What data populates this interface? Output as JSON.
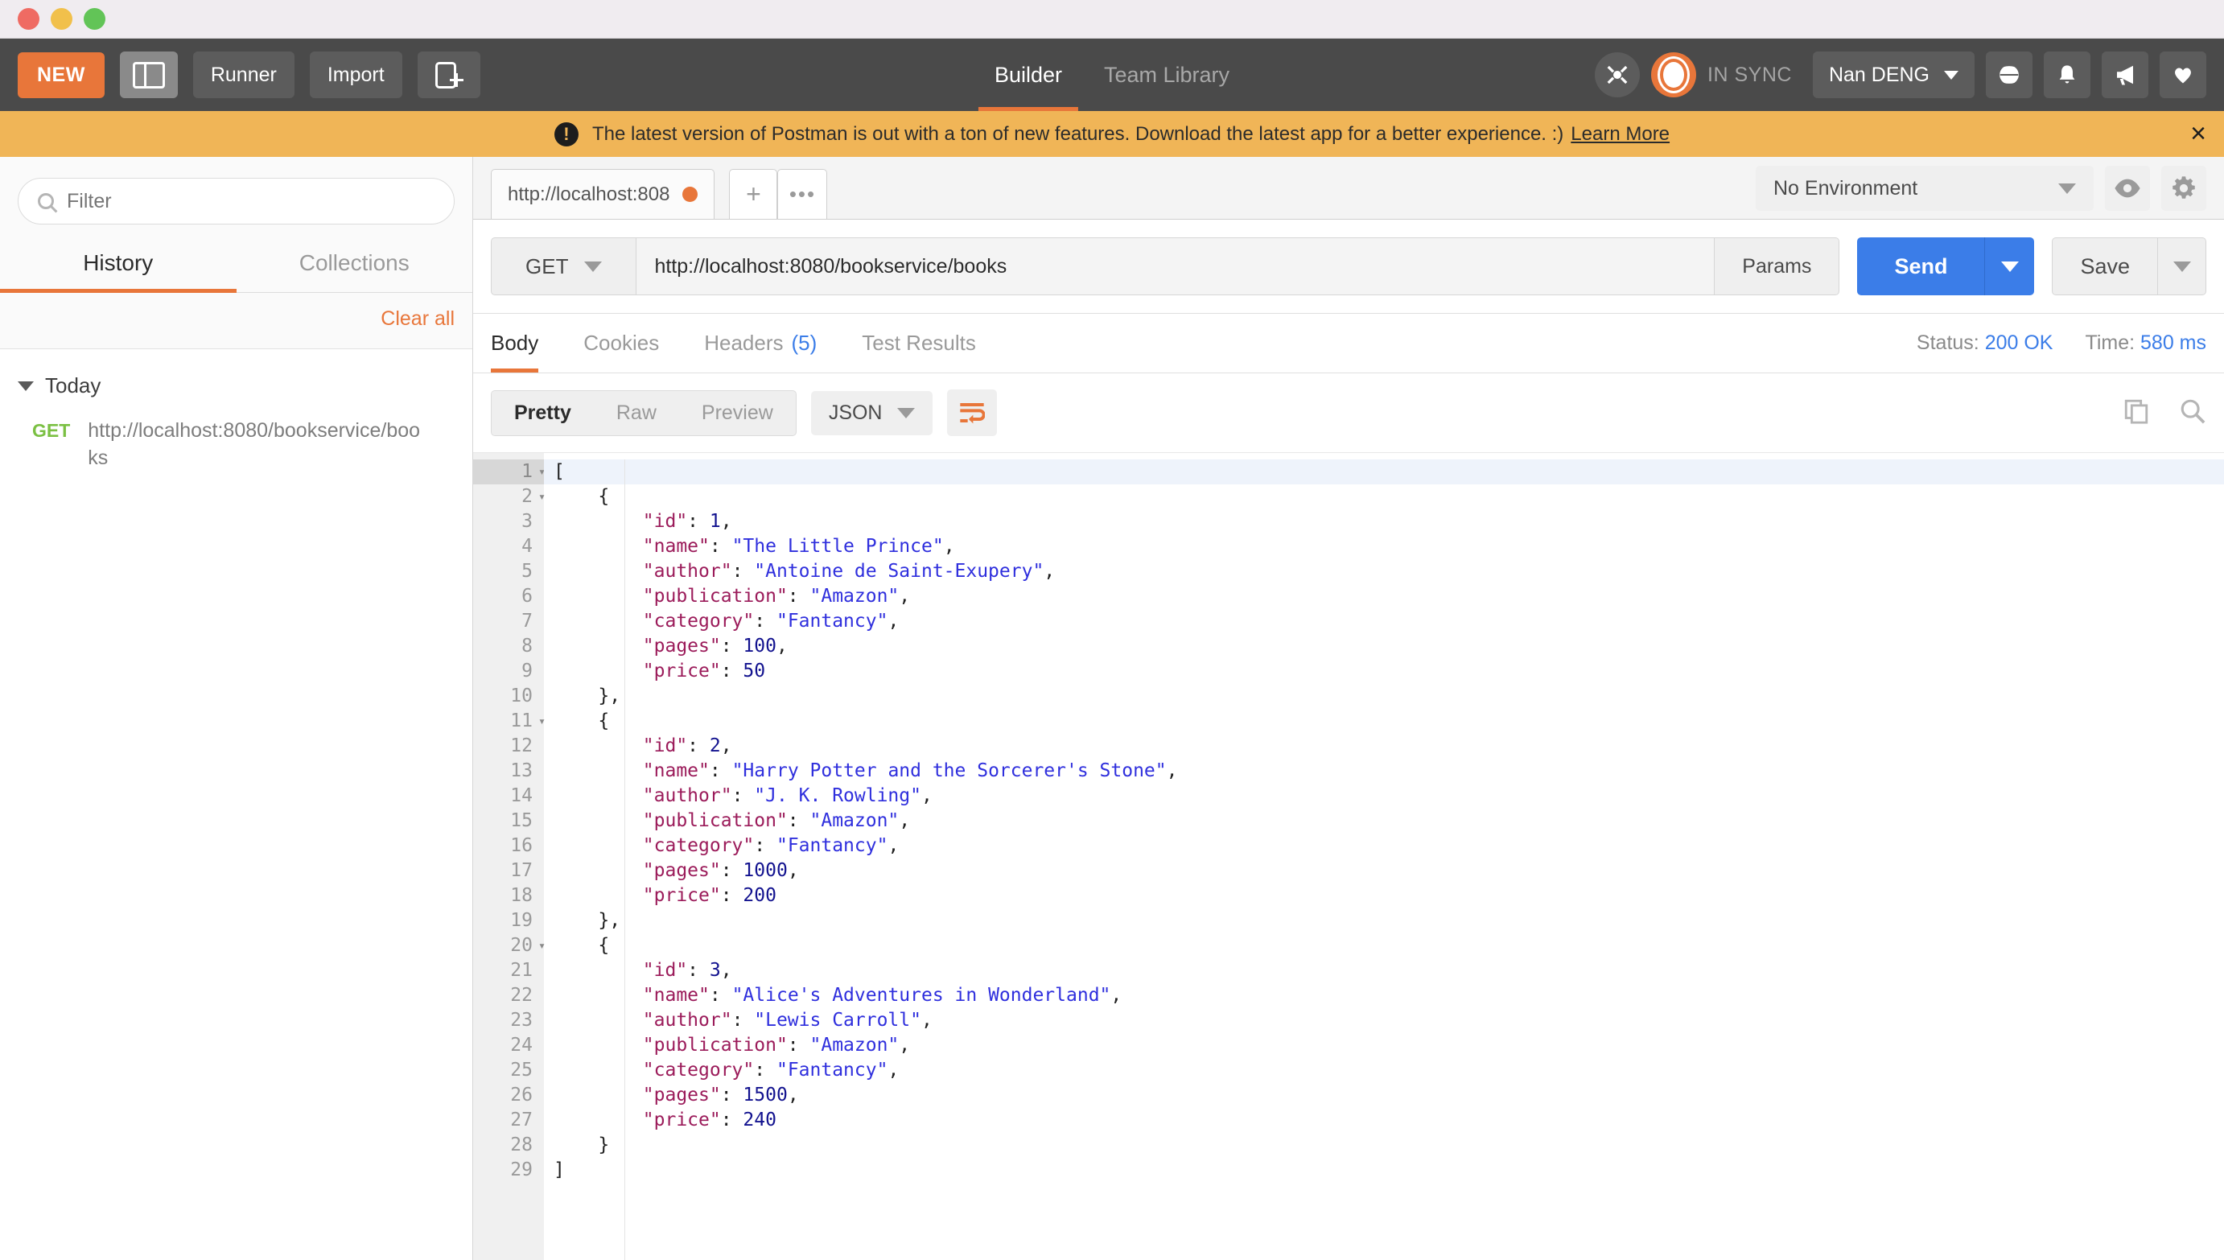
{
  "window": {
    "dots": [
      "close",
      "minimize",
      "maximize"
    ]
  },
  "header": {
    "new_button": "NEW",
    "sidebar_toggle_icon": "sidebar-toggle-icon",
    "runner_button": "Runner",
    "import_button": "Import",
    "new_tab_icon": "new-tab-icon",
    "tabs": [
      {
        "label": "Builder",
        "active": true
      },
      {
        "label": "Team Library",
        "active": false
      }
    ],
    "interceptor_icon": "interceptor-icon",
    "sync_status": "IN SYNC",
    "user_name": "Nan DENG",
    "icons": [
      "globe-icon",
      "bell-icon",
      "megaphone-icon",
      "heart-icon"
    ]
  },
  "banner": {
    "message": "The latest version of Postman is out with a ton of new features. Download the latest app for a better experience. :)",
    "link": "Learn More",
    "close": "×"
  },
  "sidebar": {
    "filter_placeholder": "Filter",
    "tabs": [
      {
        "label": "History",
        "active": true
      },
      {
        "label": "Collections",
        "active": false
      }
    ],
    "clear_all": "Clear all",
    "groups": [
      {
        "label": "Today",
        "items": [
          {
            "method": "GET",
            "url": "http://localhost:8080/bookservice/books"
          }
        ]
      }
    ]
  },
  "request": {
    "tab_title": "http://localhost:808",
    "tab_unsaved": true,
    "new_tab_plus": "+",
    "tab_more": "•••",
    "environment": "No Environment",
    "eye_icon": "eye-icon",
    "gear_icon": "gear-icon",
    "method": "GET",
    "url": "http://localhost:8080/bookservice/books",
    "params_label": "Params",
    "send_label": "Send",
    "save_label": "Save"
  },
  "response": {
    "tabs": [
      {
        "label": "Body",
        "count": "",
        "active": true
      },
      {
        "label": "Cookies",
        "count": "",
        "active": false
      },
      {
        "label": "Headers",
        "count": "(5)",
        "active": false
      },
      {
        "label": "Test Results",
        "count": "",
        "active": false
      }
    ],
    "status_label": "Status:",
    "status_value": "200 OK",
    "time_label": "Time:",
    "time_value": "580 ms",
    "view_modes": [
      {
        "label": "Pretty",
        "active": true
      },
      {
        "label": "Raw",
        "active": false
      },
      {
        "label": "Preview",
        "active": false
      }
    ],
    "format": "JSON",
    "wrap_icon": "word-wrap-icon",
    "copy_icon": "copy-icon",
    "search_icon": "search-icon",
    "body_lines": [
      {
        "n": 1,
        "fold": true,
        "indent": 0,
        "tokens": [
          [
            "p",
            "["
          ]
        ]
      },
      {
        "n": 2,
        "fold": true,
        "indent": 1,
        "tokens": [
          [
            "p",
            "{"
          ]
        ]
      },
      {
        "n": 3,
        "fold": false,
        "indent": 2,
        "tokens": [
          [
            "k",
            "\"id\""
          ],
          [
            "p",
            ": "
          ],
          [
            "n",
            "1"
          ],
          [
            "p",
            ","
          ]
        ]
      },
      {
        "n": 4,
        "fold": false,
        "indent": 2,
        "tokens": [
          [
            "k",
            "\"name\""
          ],
          [
            "p",
            ": "
          ],
          [
            "s",
            "\"The Little Prince\""
          ],
          [
            "p",
            ","
          ]
        ]
      },
      {
        "n": 5,
        "fold": false,
        "indent": 2,
        "tokens": [
          [
            "k",
            "\"author\""
          ],
          [
            "p",
            ": "
          ],
          [
            "s",
            "\"Antoine de Saint-Exupery\""
          ],
          [
            "p",
            ","
          ]
        ]
      },
      {
        "n": 6,
        "fold": false,
        "indent": 2,
        "tokens": [
          [
            "k",
            "\"publication\""
          ],
          [
            "p",
            ": "
          ],
          [
            "s",
            "\"Amazon\""
          ],
          [
            "p",
            ","
          ]
        ]
      },
      {
        "n": 7,
        "fold": false,
        "indent": 2,
        "tokens": [
          [
            "k",
            "\"category\""
          ],
          [
            "p",
            ": "
          ],
          [
            "s",
            "\"Fantancy\""
          ],
          [
            "p",
            ","
          ]
        ]
      },
      {
        "n": 8,
        "fold": false,
        "indent": 2,
        "tokens": [
          [
            "k",
            "\"pages\""
          ],
          [
            "p",
            ": "
          ],
          [
            "n",
            "100"
          ],
          [
            "p",
            ","
          ]
        ]
      },
      {
        "n": 9,
        "fold": false,
        "indent": 2,
        "tokens": [
          [
            "k",
            "\"price\""
          ],
          [
            "p",
            ": "
          ],
          [
            "n",
            "50"
          ]
        ]
      },
      {
        "n": 10,
        "fold": false,
        "indent": 1,
        "tokens": [
          [
            "p",
            "},"
          ]
        ]
      },
      {
        "n": 11,
        "fold": true,
        "indent": 1,
        "tokens": [
          [
            "p",
            "{"
          ]
        ]
      },
      {
        "n": 12,
        "fold": false,
        "indent": 2,
        "tokens": [
          [
            "k",
            "\"id\""
          ],
          [
            "p",
            ": "
          ],
          [
            "n",
            "2"
          ],
          [
            "p",
            ","
          ]
        ]
      },
      {
        "n": 13,
        "fold": false,
        "indent": 2,
        "tokens": [
          [
            "k",
            "\"name\""
          ],
          [
            "p",
            ": "
          ],
          [
            "s",
            "\"Harry Potter and the Sorcerer's Stone\""
          ],
          [
            "p",
            ","
          ]
        ]
      },
      {
        "n": 14,
        "fold": false,
        "indent": 2,
        "tokens": [
          [
            "k",
            "\"author\""
          ],
          [
            "p",
            ": "
          ],
          [
            "s",
            "\"J. K. Rowling\""
          ],
          [
            "p",
            ","
          ]
        ]
      },
      {
        "n": 15,
        "fold": false,
        "indent": 2,
        "tokens": [
          [
            "k",
            "\"publication\""
          ],
          [
            "p",
            ": "
          ],
          [
            "s",
            "\"Amazon\""
          ],
          [
            "p",
            ","
          ]
        ]
      },
      {
        "n": 16,
        "fold": false,
        "indent": 2,
        "tokens": [
          [
            "k",
            "\"category\""
          ],
          [
            "p",
            ": "
          ],
          [
            "s",
            "\"Fantancy\""
          ],
          [
            "p",
            ","
          ]
        ]
      },
      {
        "n": 17,
        "fold": false,
        "indent": 2,
        "tokens": [
          [
            "k",
            "\"pages\""
          ],
          [
            "p",
            ": "
          ],
          [
            "n",
            "1000"
          ],
          [
            "p",
            ","
          ]
        ]
      },
      {
        "n": 18,
        "fold": false,
        "indent": 2,
        "tokens": [
          [
            "k",
            "\"price\""
          ],
          [
            "p",
            ": "
          ],
          [
            "n",
            "200"
          ]
        ]
      },
      {
        "n": 19,
        "fold": false,
        "indent": 1,
        "tokens": [
          [
            "p",
            "},"
          ]
        ]
      },
      {
        "n": 20,
        "fold": true,
        "indent": 1,
        "tokens": [
          [
            "p",
            "{"
          ]
        ]
      },
      {
        "n": 21,
        "fold": false,
        "indent": 2,
        "tokens": [
          [
            "k",
            "\"id\""
          ],
          [
            "p",
            ": "
          ],
          [
            "n",
            "3"
          ],
          [
            "p",
            ","
          ]
        ]
      },
      {
        "n": 22,
        "fold": false,
        "indent": 2,
        "tokens": [
          [
            "k",
            "\"name\""
          ],
          [
            "p",
            ": "
          ],
          [
            "s",
            "\"Alice's Adventures in Wonderland\""
          ],
          [
            "p",
            ","
          ]
        ]
      },
      {
        "n": 23,
        "fold": false,
        "indent": 2,
        "tokens": [
          [
            "k",
            "\"author\""
          ],
          [
            "p",
            ": "
          ],
          [
            "s",
            "\"Lewis Carroll\""
          ],
          [
            "p",
            ","
          ]
        ]
      },
      {
        "n": 24,
        "fold": false,
        "indent": 2,
        "tokens": [
          [
            "k",
            "\"publication\""
          ],
          [
            "p",
            ": "
          ],
          [
            "s",
            "\"Amazon\""
          ],
          [
            "p",
            ","
          ]
        ]
      },
      {
        "n": 25,
        "fold": false,
        "indent": 2,
        "tokens": [
          [
            "k",
            "\"category\""
          ],
          [
            "p",
            ": "
          ],
          [
            "s",
            "\"Fantancy\""
          ],
          [
            "p",
            ","
          ]
        ]
      },
      {
        "n": 26,
        "fold": false,
        "indent": 2,
        "tokens": [
          [
            "k",
            "\"pages\""
          ],
          [
            "p",
            ": "
          ],
          [
            "n",
            "1500"
          ],
          [
            "p",
            ","
          ]
        ]
      },
      {
        "n": 27,
        "fold": false,
        "indent": 2,
        "tokens": [
          [
            "k",
            "\"price\""
          ],
          [
            "p",
            ": "
          ],
          [
            "n",
            "240"
          ]
        ]
      },
      {
        "n": 28,
        "fold": false,
        "indent": 1,
        "tokens": [
          [
            "p",
            "}"
          ]
        ]
      },
      {
        "n": 29,
        "fold": false,
        "indent": 0,
        "tokens": [
          [
            "p",
            "]"
          ]
        ]
      }
    ]
  },
  "colors": {
    "accent_orange": "#e8763a",
    "banner_orange": "#f0b557",
    "send_blue": "#3b7de8",
    "get_green": "#7bc043",
    "json_key": "#9b1b5a",
    "json_string": "#2f2fdd",
    "json_number": "#12128f"
  }
}
